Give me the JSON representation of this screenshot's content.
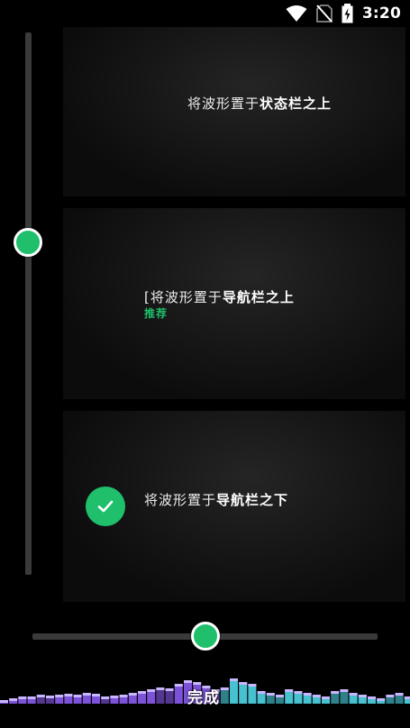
{
  "status_bar": {
    "time": "3:20",
    "icons": [
      "wifi-icon",
      "no-sim-icon",
      "battery-charging-icon"
    ]
  },
  "options": [
    {
      "prefix": "将波形置于",
      "emphasis": "状态栏之上",
      "selected": false
    },
    {
      "prefix": "[将波形置于",
      "emphasis": "导航栏之上",
      "tag": "推荐",
      "selected": false
    },
    {
      "prefix": "将波形置于",
      "emphasis": "导航栏之下",
      "selected": true
    }
  ],
  "done_label": "完成",
  "colors": {
    "accent": "#1fbf6b",
    "track": "#3a3a3a",
    "wave_purple": "#8a5cf0",
    "wave_cyan": "#4fd6e6"
  }
}
